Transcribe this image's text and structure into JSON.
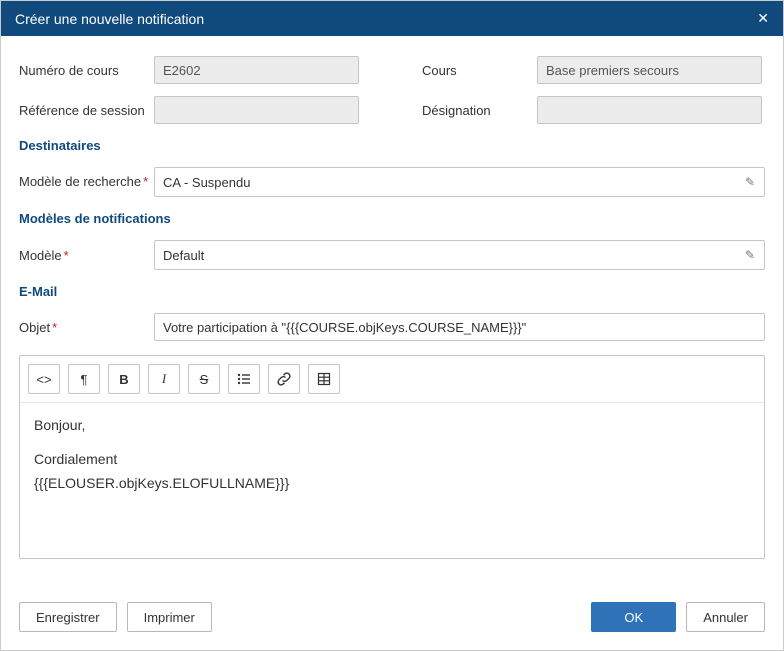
{
  "dialog": {
    "title": "Créer une nouvelle notification"
  },
  "fields": {
    "course_number_label": "Numéro de cours",
    "course_number_value": "E2602",
    "course_label": "Cours",
    "course_value": "Base premiers secours",
    "session_ref_label": "Référence de session",
    "session_ref_value": "",
    "designation_label": "Désignation",
    "designation_value": ""
  },
  "sections": {
    "recipients": "Destinataires",
    "templates": "Modèles de notifications",
    "email": "E-Mail"
  },
  "recipients": {
    "search_model_label": "Modèle de recherche",
    "search_model_value": "CA - Suspendu"
  },
  "templates": {
    "model_label": "Modèle",
    "model_value": "Default"
  },
  "email": {
    "subject_label": "Objet",
    "subject_value": "Votre participation à \"{{{COURSE.objKeys.COURSE_NAME}}}\"",
    "body_greeting": "Bonjour,",
    "body_signoff": "Cordialement",
    "body_signature": "{{{ELOUSER.objKeys.ELOFULLNAME}}}"
  },
  "toolbar": {
    "bold": "B",
    "italic": "I",
    "strike": "S"
  },
  "buttons": {
    "save": "Enregistrer",
    "print": "Imprimer",
    "ok": "OK",
    "cancel": "Annuler"
  },
  "glyphs": {
    "close": "✕",
    "pencil": "✎",
    "code": "<>",
    "pilcrow": "¶",
    "required": "*"
  }
}
